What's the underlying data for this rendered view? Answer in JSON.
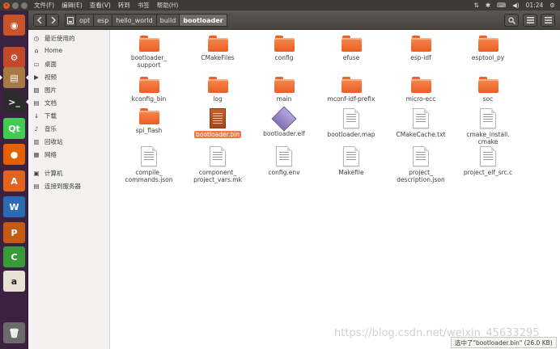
{
  "top_panel": {
    "menu": [
      "文件(F)",
      "编辑(E)",
      "查看(V)",
      "转到",
      "书签",
      "帮助(H)"
    ],
    "time": "01:24"
  },
  "launcher": {
    "apps": [
      {
        "name": "ubuntu-dash-icon",
        "glyph": "◉",
        "color": "#c9542a"
      },
      {
        "name": "system-settings-icon",
        "glyph": "⚙",
        "color": "#c24a2a"
      },
      {
        "name": "files-icon",
        "glyph": "▤",
        "color": "#a77a45"
      },
      {
        "name": "terminal-icon",
        "glyph": ">_",
        "color": "#2b2b2b"
      },
      {
        "name": "qt-creator-icon",
        "glyph": "Qt",
        "color": "#41cd52"
      },
      {
        "name": "firefox-icon",
        "glyph": "●",
        "color": "#e66000"
      },
      {
        "name": "software-center-icon",
        "glyph": "A",
        "color": "#e2631e"
      },
      {
        "name": "writer-icon",
        "glyph": "W",
        "color": "#2a6bb2"
      },
      {
        "name": "impress-icon",
        "glyph": "P",
        "color": "#c55a15"
      },
      {
        "name": "calc-icon",
        "glyph": "C",
        "color": "#3a9a3a"
      },
      {
        "name": "amazon-icon",
        "glyph": "a",
        "color": "#e7e1d4"
      },
      {
        "name": "trash-icon",
        "glyph": "🗑",
        "color": "#6b6b6b"
      }
    ]
  },
  "breadcrumbs": [
    "opt",
    "esp",
    "hello_world",
    "build",
    "bootloader"
  ],
  "sidebar": {
    "items": [
      {
        "label": "最近使用的",
        "icon": "clock-icon"
      },
      {
        "label": "Home",
        "icon": "home-icon"
      },
      {
        "label": "桌面",
        "icon": "desktop-icon"
      },
      {
        "label": "视频",
        "icon": "video-icon"
      },
      {
        "label": "图片",
        "icon": "picture-icon"
      },
      {
        "label": "文档",
        "icon": "document-icon"
      },
      {
        "label": "下载",
        "icon": "download-icon"
      },
      {
        "label": "音乐",
        "icon": "music-icon"
      },
      {
        "label": "回收站",
        "icon": "trash-icon"
      },
      {
        "label": "网络",
        "icon": "network-icon"
      },
      {
        "label": "计算机",
        "icon": "computer-icon"
      },
      {
        "label": "连接到服务器",
        "icon": "server-icon"
      }
    ]
  },
  "files": [
    {
      "label": "bootloader_\nsupport",
      "kind": "folder"
    },
    {
      "label": "CMakeFiles",
      "kind": "folder"
    },
    {
      "label": "config",
      "kind": "folder"
    },
    {
      "label": "efuse",
      "kind": "folder"
    },
    {
      "label": "esp-idf",
      "kind": "folder"
    },
    {
      "label": "esptool_py",
      "kind": "folder"
    },
    {
      "label": "kconfig_bin",
      "kind": "folder"
    },
    {
      "label": "log",
      "kind": "folder"
    },
    {
      "label": "main",
      "kind": "folder"
    },
    {
      "label": "mconf-idf-prefix",
      "kind": "folder"
    },
    {
      "label": "micro-ecc",
      "kind": "folder"
    },
    {
      "label": "soc",
      "kind": "folder"
    },
    {
      "label": "spi_flash",
      "kind": "folder"
    },
    {
      "label": "bootloader.bin",
      "kind": "bin",
      "selected": true
    },
    {
      "label": "bootloader.elf",
      "kind": "elf"
    },
    {
      "label": "bootloader.map",
      "kind": "doc"
    },
    {
      "label": "CMakeCache.txt",
      "kind": "doc"
    },
    {
      "label": "cmake_install.\ncmake",
      "kind": "doc"
    },
    {
      "label": "compile_\ncommands.json",
      "kind": "doc"
    },
    {
      "label": "component_\nproject_vars.mk",
      "kind": "doc"
    },
    {
      "label": "config.env",
      "kind": "doc"
    },
    {
      "label": "Makefile",
      "kind": "doc"
    },
    {
      "label": "project_\ndescription.json",
      "kind": "doc"
    },
    {
      "label": "project_elf_src.c",
      "kind": "doc"
    }
  ],
  "status": "选中了\"bootloader.bin\" (26.0 KB)",
  "watermark": "https://blog.csdn.net/weixin_45633295"
}
